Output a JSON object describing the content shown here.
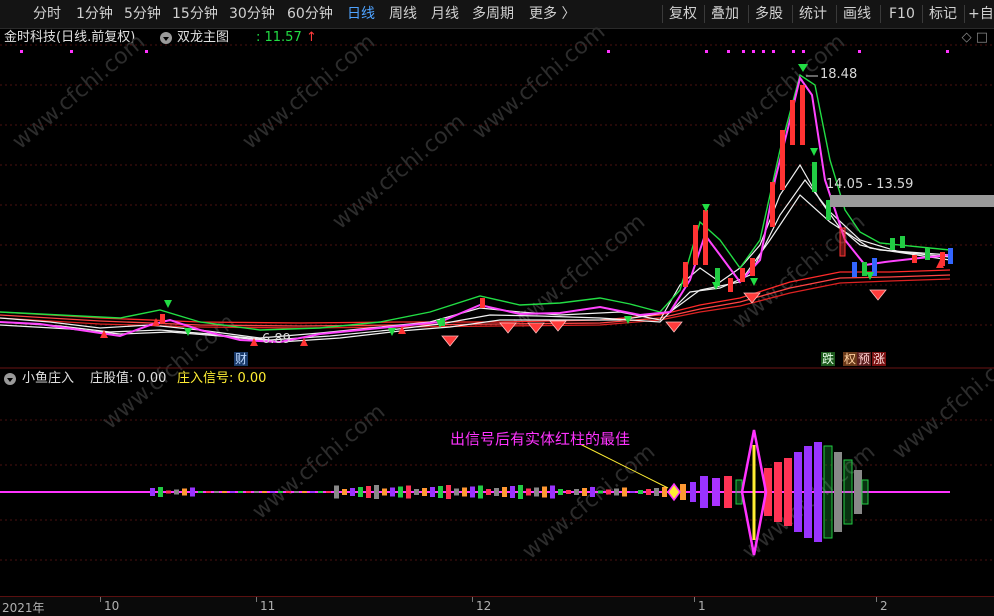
{
  "toolbar": {
    "periods": [
      "分时",
      "1分钟",
      "5分钟",
      "15分钟",
      "30分钟",
      "60分钟",
      "日线",
      "周线",
      "月线",
      "多周期",
      "更多 〉"
    ],
    "active_period": "日线",
    "right_tools": [
      "复权",
      "叠加",
      "多股",
      "统计",
      "画线",
      "F10",
      "标记",
      "+自"
    ]
  },
  "main_panel": {
    "stock_name": "金时科技(日线.前复权)",
    "indicator_name": "双龙主图",
    "price_label": ": 11.57",
    "price_arrow": "↑",
    "window_icons": "◇  □",
    "high_label": "18.48",
    "range_label": "14.05 - 13.59",
    "low_label": "6.89",
    "badge_cai": "财",
    "badge_die": "跌",
    "badge_yu": "预",
    "badge_zhang": "涨",
    "badge_huan": "权"
  },
  "lower_panel": {
    "indicator_name": "小鱼庄入",
    "label1": "庄股值: 0.00",
    "label2": "庄入信号: 0.00",
    "annotation": "出信号后有实体红柱的最佳"
  },
  "x_axis": {
    "labels": [
      "2021年",
      "10",
      "11",
      "12",
      "1",
      "2"
    ]
  },
  "watermark": "www.cfchi.com",
  "colors": {
    "up": "#ff3b3b",
    "down": "#22cc44",
    "active_tab": "#4fa3ff",
    "magenta": "#ff33ff",
    "yellow": "#ffee33"
  }
}
